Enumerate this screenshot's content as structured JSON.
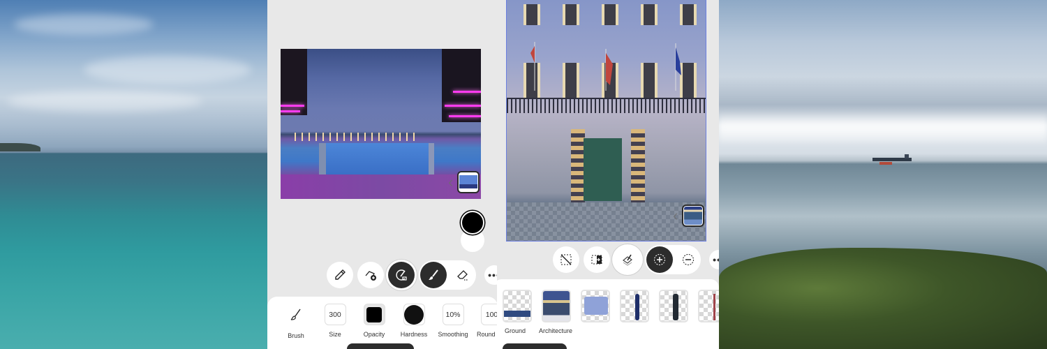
{
  "left_screen": {
    "photo_description": "Rooftop infinity pool at dusk with magenta lights",
    "thumbnail_nav": {
      "chevron": "‹"
    },
    "toolbar": [
      {
        "name": "eyedropper",
        "icon": "eyedropper-icon"
      },
      {
        "name": "add-selection-cloud",
        "icon": "cloud-add-icon"
      },
      {
        "name": "refine-brush",
        "icon": "refine-brush-icon",
        "active": true
      },
      {
        "name": "brush",
        "icon": "brush-icon",
        "active": true
      },
      {
        "name": "eraser",
        "icon": "eraser-icon"
      },
      {
        "name": "more",
        "icon": "more-icon",
        "label": "•••"
      }
    ],
    "brush_settings": [
      {
        "label": "Brush",
        "value": "",
        "kind": "icon"
      },
      {
        "label": "Size",
        "value": "300",
        "kind": "text"
      },
      {
        "label": "Opacity",
        "value": "",
        "kind": "square-swatch"
      },
      {
        "label": "Hardness",
        "value": "",
        "kind": "circle-swatch"
      },
      {
        "label": "Smoothing",
        "value": "10%",
        "kind": "text"
      },
      {
        "label": "Round",
        "value": "100",
        "kind": "text"
      }
    ],
    "colors": {
      "foreground": "#000000",
      "background": "#ffffff"
    }
  },
  "right_screen": {
    "photo_description": "Baroque palace facade with flags and green door",
    "thumbnail_nav": {
      "chevron": "‹"
    },
    "toolbar": [
      {
        "name": "deselect",
        "icon": "deselect-icon"
      },
      {
        "name": "invert-selection",
        "icon": "invert-selection-icon"
      },
      {
        "name": "refine-edge",
        "icon": "refine-edge-icon"
      },
      {
        "name": "add-to-selection",
        "icon": "selection-add-icon",
        "active": true
      },
      {
        "name": "subtract-from-selection",
        "icon": "selection-subtract-icon"
      },
      {
        "name": "more",
        "icon": "more-icon",
        "label": "•••"
      }
    ],
    "layers": [
      {
        "label": "Ground"
      },
      {
        "label": "Architecture"
      },
      {
        "label": ""
      },
      {
        "label": ""
      },
      {
        "label": ""
      },
      {
        "label": ""
      }
    ]
  },
  "colors": {
    "panel": "#e8e8e8",
    "sheet": "#ffffff",
    "active": "#2c2c2c",
    "selection_outline": "#6b7fe0"
  }
}
